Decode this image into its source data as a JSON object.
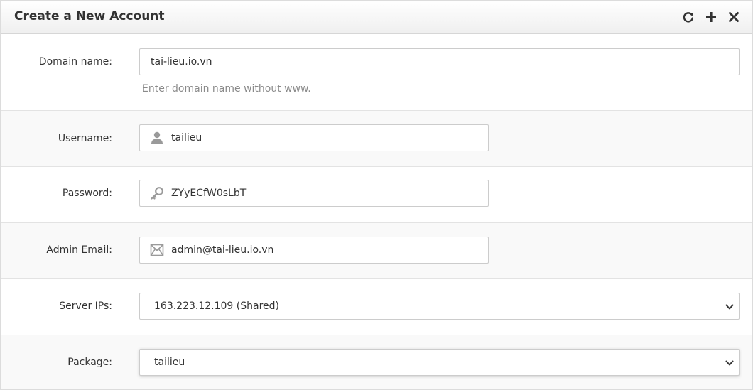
{
  "header": {
    "title": "Create a New Account",
    "tools": [
      {
        "name": "refresh-icon"
      },
      {
        "name": "plus-icon"
      },
      {
        "name": "close-icon"
      }
    ]
  },
  "form": {
    "domain": {
      "label": "Domain name:",
      "value": "tai-lieu.io.vn",
      "help": "Enter domain name without www."
    },
    "username": {
      "label": "Username:",
      "value": "tailieu",
      "icon": "user-icon"
    },
    "password": {
      "label": "Password:",
      "value": "ZYyECfW0sLbT",
      "icon": "key-icon"
    },
    "email": {
      "label": "Admin Email:",
      "value": "admin@tai-lieu.io.vn",
      "icon": "envelope-icon"
    },
    "server_ips": {
      "label": "Server IPs:",
      "selected": "163.223.12.109 (Shared)"
    },
    "package": {
      "label": "Package:",
      "selected": "tailieu"
    }
  },
  "colors": {
    "header_bg": "#f2f2f2",
    "row_shaded_bg": "#f9f9f9",
    "border": "#cccccc",
    "help_text": "#8a8a8a",
    "icon_gray": "#9a9a9a"
  }
}
